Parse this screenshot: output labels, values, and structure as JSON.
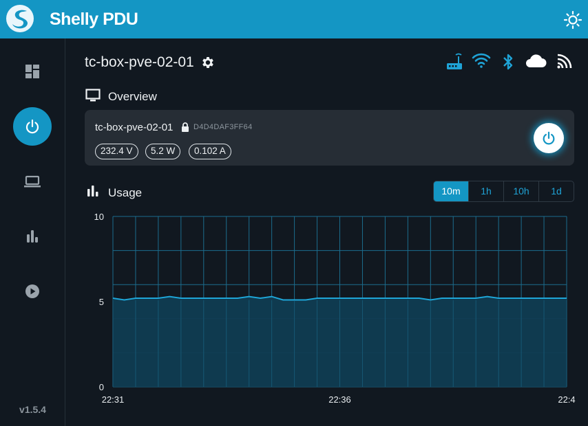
{
  "app": {
    "title": "Shelly PDU",
    "version": "v1.5.4"
  },
  "icons": {
    "logo": "shelly-logo",
    "theme_toggle": "sun-icon",
    "nav": [
      "dashboard-icon",
      "power-icon",
      "laptop-icon",
      "bar-chart-icon",
      "play-circle-icon"
    ],
    "status": [
      "ethernet-router-icon",
      "wifi-icon",
      "bluetooth-icon",
      "cloud-icon",
      "rss-feed-icon"
    ]
  },
  "device": {
    "name": "tc-box-pve-02-01"
  },
  "overview": {
    "title": "Overview",
    "card": {
      "name": "tc-box-pve-02-01",
      "id": "D4D4DAF3FF64",
      "voltage": "232.4 V",
      "power": "5.2 W",
      "current": "0.102 A"
    }
  },
  "usage": {
    "title": "Usage",
    "ranges": [
      "10m",
      "1h",
      "10h",
      "1d"
    ],
    "active_range": "10m"
  },
  "colors": {
    "accent": "#1496c4",
    "background": "#111820",
    "card": "#262d35",
    "chart_fill": "#103c52",
    "chart_line": "#1ea6d8"
  },
  "chart_data": {
    "type": "area",
    "title": "",
    "xlabel": "",
    "ylabel": "",
    "ylim": [
      0,
      10
    ],
    "yticks": [
      0,
      5,
      10
    ],
    "xtick_labels": [
      "22:31",
      "22:36",
      "22:4"
    ],
    "x": [
      "22:31:00",
      "22:31:15",
      "22:31:30",
      "22:31:45",
      "22:32:00",
      "22:32:15",
      "22:32:30",
      "22:32:45",
      "22:33:00",
      "22:33:15",
      "22:33:30",
      "22:33:45",
      "22:34:00",
      "22:34:15",
      "22:34:30",
      "22:34:45",
      "22:35:00",
      "22:35:15",
      "22:35:30",
      "22:35:45",
      "22:36:00",
      "22:36:15",
      "22:36:30",
      "22:36:45",
      "22:37:00",
      "22:37:15",
      "22:37:30",
      "22:37:45",
      "22:38:00",
      "22:38:15",
      "22:38:30",
      "22:38:45",
      "22:39:00",
      "22:39:15",
      "22:39:30",
      "22:39:45",
      "22:40:00",
      "22:40:15",
      "22:40:30",
      "22:40:45",
      "22:41:00"
    ],
    "series": [
      {
        "values": [
          5.2,
          5.1,
          5.2,
          5.2,
          5.2,
          5.3,
          5.2,
          5.2,
          5.2,
          5.2,
          5.2,
          5.2,
          5.3,
          5.2,
          5.3,
          5.1,
          5.1,
          5.1,
          5.2,
          5.2,
          5.2,
          5.2,
          5.2,
          5.2,
          5.2,
          5.2,
          5.2,
          5.2,
          5.1,
          5.2,
          5.2,
          5.2,
          5.2,
          5.3,
          5.2,
          5.2,
          5.2,
          5.2,
          5.2,
          5.2,
          5.2
        ]
      }
    ],
    "grid": true
  }
}
